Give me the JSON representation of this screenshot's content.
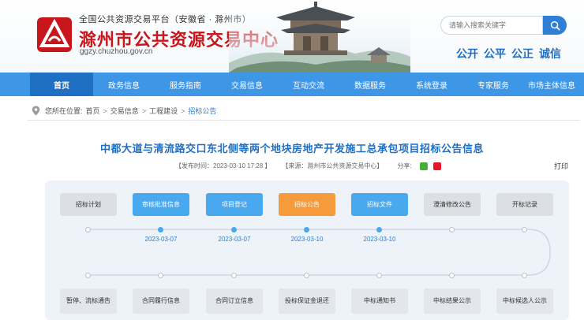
{
  "header": {
    "org_line": "全国公共资源交易平台（安徽省 · 滁州市）",
    "site_title": "滁州市公共资源交易中心",
    "site_domain": "ggzy.chuzhou.gov.cn",
    "search_placeholder": "请输入搜索关键字",
    "slogans": [
      "公开",
      "公平",
      "公正",
      "诚信"
    ]
  },
  "nav": [
    "首页",
    "政务信息",
    "服务指南",
    "交易信息",
    "互动交流",
    "数据服务",
    "系统登录",
    "专家服务",
    "市场主体信息"
  ],
  "breadcrumb": {
    "prefix": "您所在位置:",
    "items": [
      "首页",
      "交易信息",
      "工程建设",
      "招标公告"
    ]
  },
  "article": {
    "title": "中都大道与清流路交口东北侧等两个地块房地产开发施工总承包项目招标公告信息",
    "publish_time": "【发布时间：2023-03-10 17:28 】",
    "source": "【来源：滁州市公共资源交易中心】",
    "share_label": "分享:",
    "print_label": "打印"
  },
  "flow": {
    "top_steps": [
      {
        "label": "招标计划",
        "state": "pending",
        "date": ""
      },
      {
        "label": "审核批准信息",
        "state": "done",
        "date": "2023-03-07"
      },
      {
        "label": "项目登记",
        "state": "done",
        "date": "2023-03-07"
      },
      {
        "label": "招标公告",
        "state": "current",
        "date": "2023-03-10"
      },
      {
        "label": "招标文件",
        "state": "done",
        "date": "2023-03-10"
      },
      {
        "label": "澄清修改公告",
        "state": "pending",
        "date": ""
      },
      {
        "label": "开标记录",
        "state": "pending",
        "date": ""
      }
    ],
    "bottom_steps": [
      {
        "label": "暂停、流标通告"
      },
      {
        "label": "合同履行信息"
      },
      {
        "label": "合同订立信息"
      },
      {
        "label": "投标保证金退还"
      },
      {
        "label": "中标通知书"
      },
      {
        "label": "中标结果公示"
      },
      {
        "label": "中标候选人公示"
      }
    ]
  },
  "colors": {
    "brand_red": "#c8161d",
    "nav_blue": "#3e96e6",
    "nav_active": "#1f6fc5",
    "step_done": "#48a9ef",
    "step_current": "#f59b3c"
  }
}
